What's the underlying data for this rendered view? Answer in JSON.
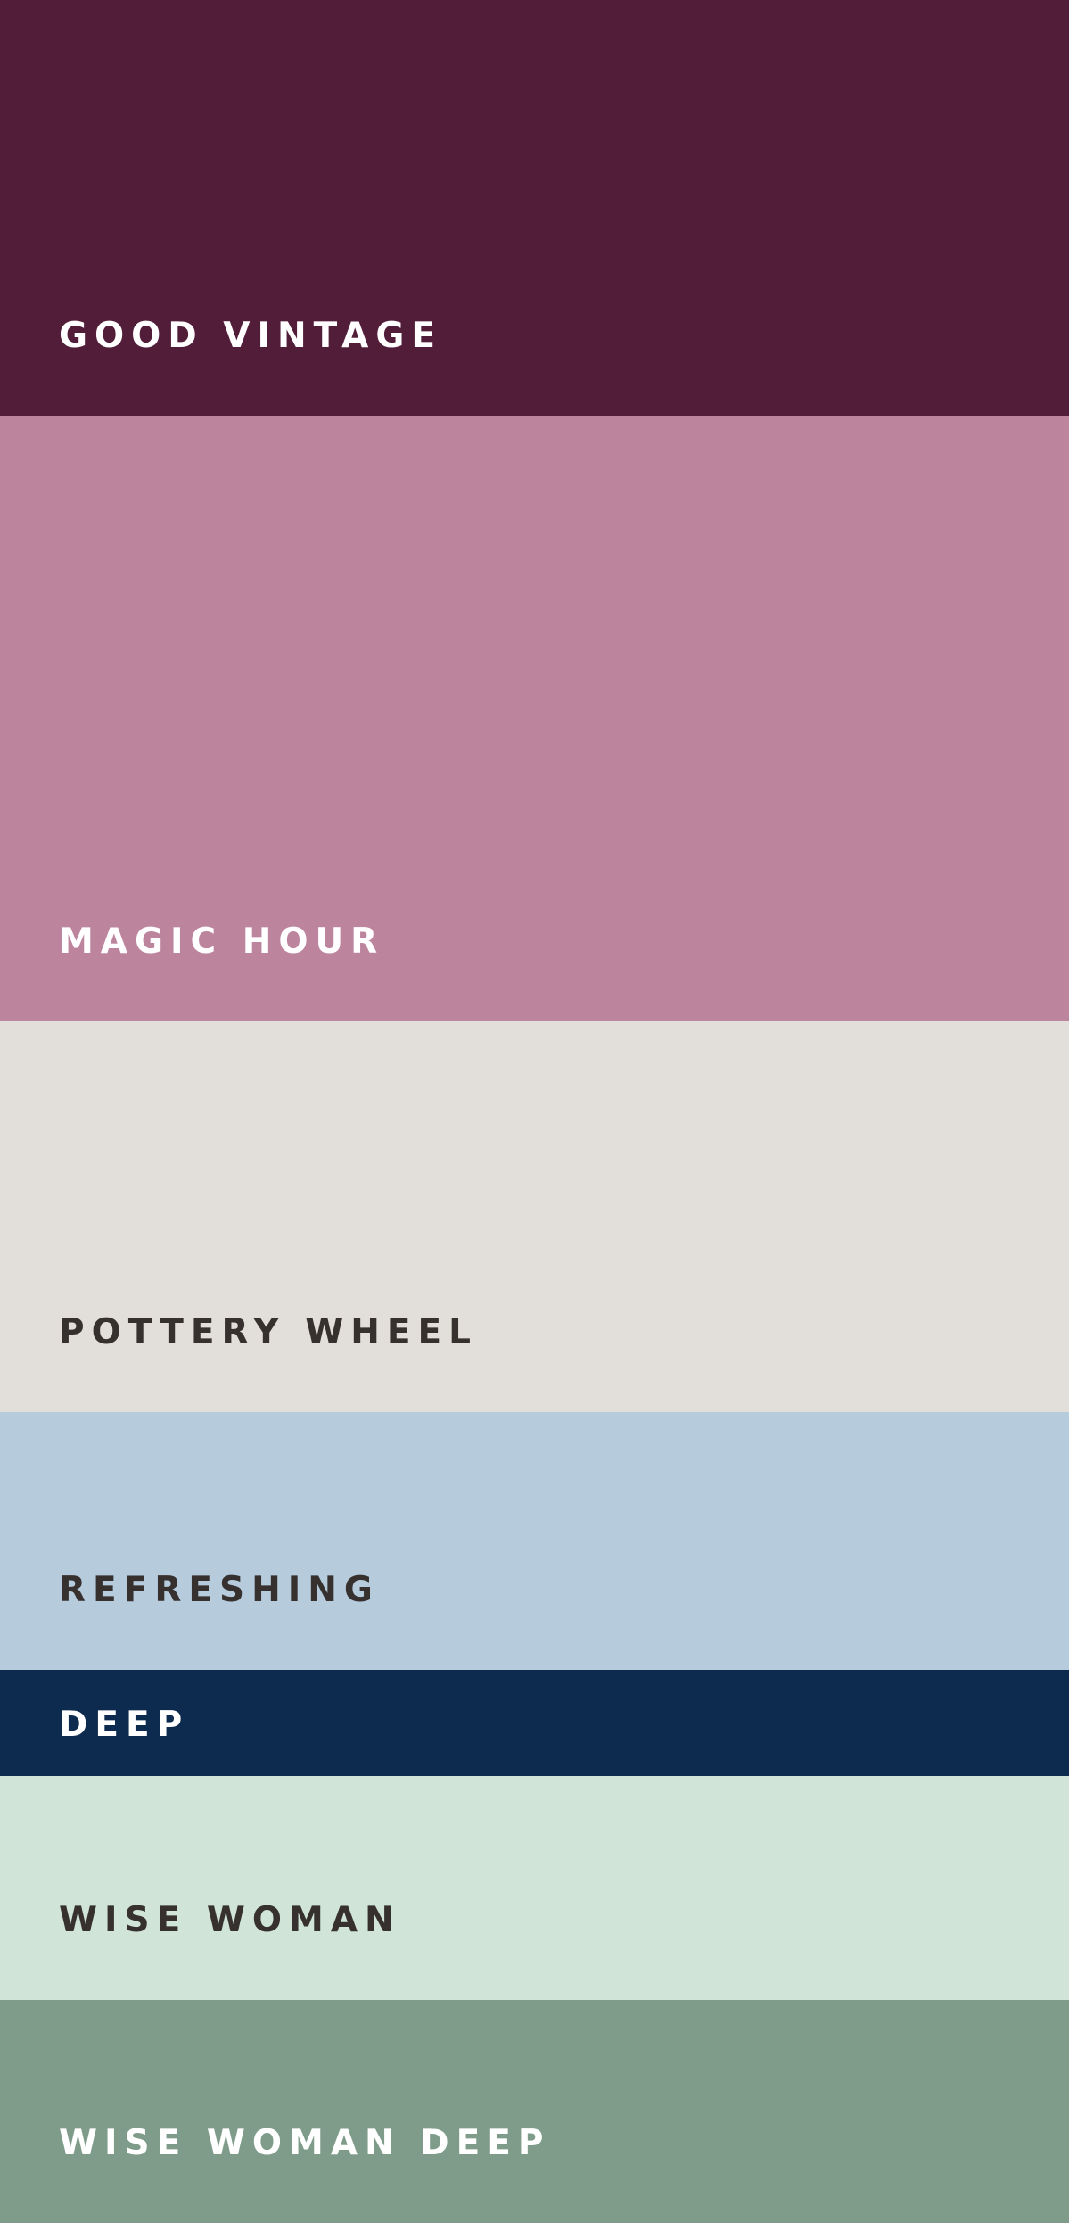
{
  "swatches": [
    {
      "label": "GOOD VINTAGE",
      "color": "#521D39",
      "text_color": "#FFFFFF"
    },
    {
      "label": "MAGIC HOUR",
      "color": "#BD849D",
      "text_color": "#FFFFFF"
    },
    {
      "label": "POTTERY WHEEL",
      "color": "#E2DED9",
      "text_color": "#36312F"
    },
    {
      "label": "REFRESHING",
      "color": "#B6CBDC",
      "text_color": "#36312F"
    },
    {
      "label": "DEEP",
      "color": "#0D2B4E",
      "text_color": "#FFFFFF"
    },
    {
      "label": "WISE WOMAN",
      "color": "#D0E4D8",
      "text_color": "#36312F"
    },
    {
      "label": "WISE WOMAN DEEP",
      "color": "#7F9C8A",
      "text_color": "#FFFFFF"
    }
  ]
}
